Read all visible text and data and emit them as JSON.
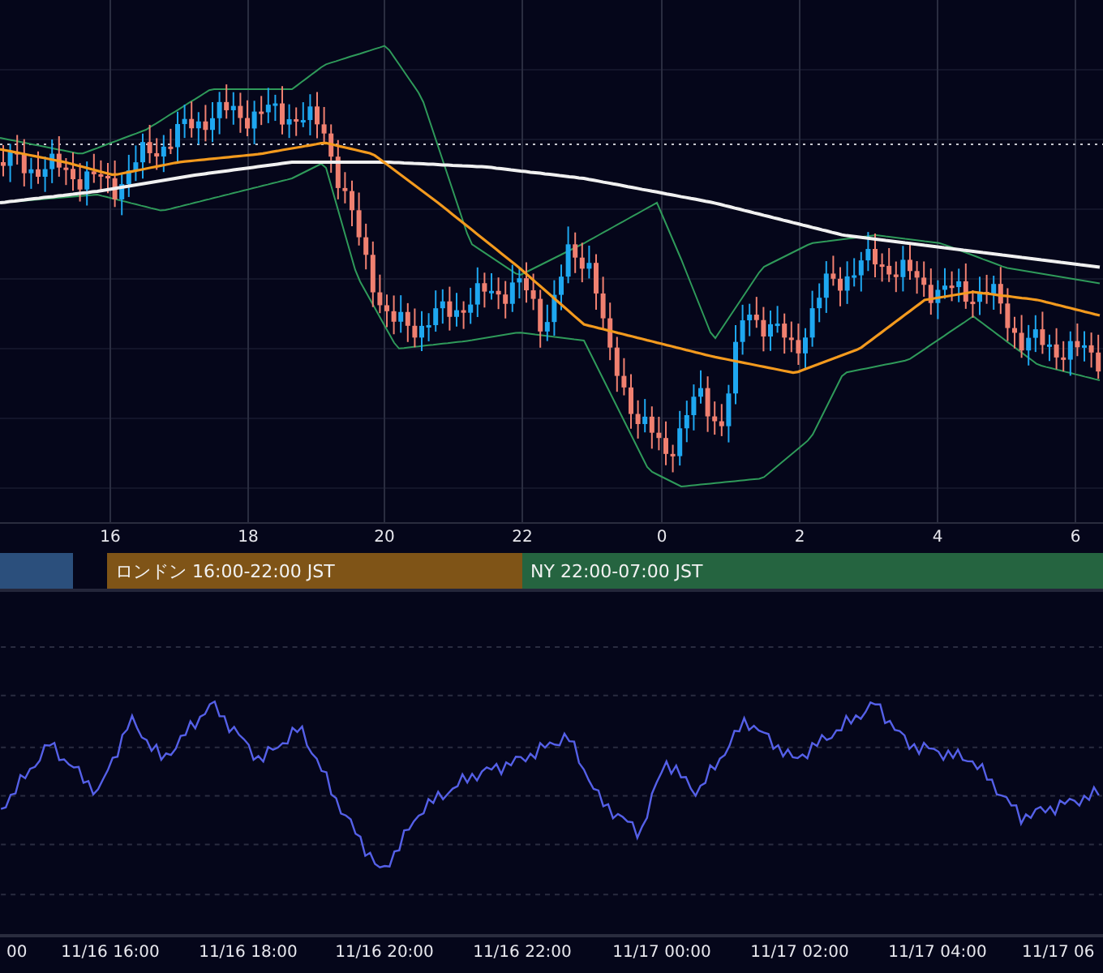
{
  "time_axis": {
    "ticks": [
      "16",
      "18",
      "20",
      "22",
      "0",
      "2",
      "4",
      "6"
    ]
  },
  "sessions": [
    {
      "color": "#2b4f7c"
    },
    {
      "label": "ロンドン 16:00-22:00 JST",
      "color": "#7f5417"
    },
    {
      "label": "NY 22:00-07:00 JST",
      "color": "#256440"
    }
  ],
  "date_axis": {
    "labels": [
      "00",
      "11/16 16:00",
      "11/16 18:00",
      "11/16 20:00",
      "11/16 22:00",
      "11/17 00:00",
      "11/17 02:00",
      "11/17 04:00",
      "11/17 06"
    ]
  }
}
